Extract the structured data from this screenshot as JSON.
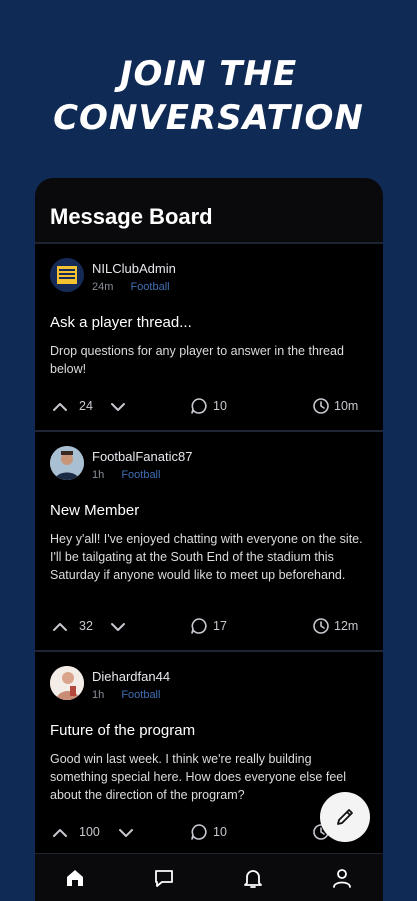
{
  "hero": {
    "line1": "JOIN THE",
    "line2": "CONVERSATION"
  },
  "board": {
    "title": "Message Board"
  },
  "posts": [
    {
      "author": "NILClubAdmin",
      "time": "24m",
      "tag": "Football",
      "title": "Ask a player thread...",
      "body": "Drop questions for any player to answer in the thread below!",
      "votes": "24",
      "comments": "10",
      "age": "10m",
      "avatar": "club-logo"
    },
    {
      "author": "FootbalFanatic87",
      "time": "1h",
      "tag": "Football",
      "title": "New Member",
      "body": "Hey y'all! I've enjoyed chatting with everyone on the site. I'll be tailgating at the South End of the stadium this Saturday if anyone would like to meet up beforehand.",
      "votes": "32",
      "comments": "17",
      "age": "12m",
      "avatar": "user-photo"
    },
    {
      "author": "Diehardfan44",
      "time": "1h",
      "tag": "Football",
      "title": "Future of the program",
      "body": "Good win last week. I think we're really building something special here. How does everyone else feel about the direction of the program?",
      "votes": "100",
      "comments": "10",
      "age": "",
      "avatar": "user-photo"
    }
  ],
  "nav": [
    "home-icon",
    "chat-icon",
    "bell-icon",
    "profile-icon"
  ],
  "colors": {
    "background": "#0f2a55",
    "panel": "#0a0a0c",
    "tag": "#3f6fb3"
  }
}
